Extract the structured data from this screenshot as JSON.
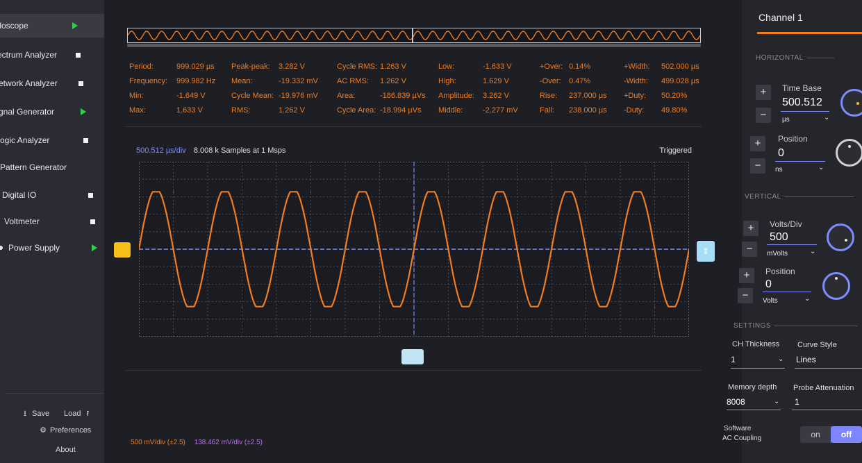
{
  "colors": {
    "channel1": "#f07d22",
    "accent": "#7e8cff",
    "trigger_yellow": "#f6c21a",
    "math": "#c46bff"
  },
  "sidebar": {
    "items": [
      {
        "label": "illoscope",
        "indicator": "play",
        "active": true
      },
      {
        "label": "ectrum Analyzer",
        "indicator": "square"
      },
      {
        "label": "etwork Analyzer",
        "indicator": "square"
      },
      {
        "label": "gnal Generator",
        "indicator": "play"
      },
      {
        "label": "ogic Analyzer",
        "indicator": "square"
      },
      {
        "label": "Pattern Generator",
        "indicator": "none"
      },
      {
        "label": "Digital IO",
        "indicator": "square"
      },
      {
        "label": "Voltmeter",
        "indicator": "square"
      },
      {
        "label": "Power Supply",
        "indicator": "play"
      }
    ],
    "save_label": "Save",
    "load_label": "Load",
    "preferences_label": "Preferences",
    "about_label": "About"
  },
  "measurements": {
    "col1": [
      {
        "key": "Period:",
        "value": "999.029 µs"
      },
      {
        "key": "Frequency:",
        "value": "999.982 Hz"
      },
      {
        "key": "Min:",
        "value": "-1.649 V"
      },
      {
        "key": "Max:",
        "value": "1.633 V"
      }
    ],
    "col2": [
      {
        "key": "Peak-peak:",
        "value": "3.282 V"
      },
      {
        "key": "Mean:",
        "value": "-19.332 mV"
      },
      {
        "key": "Cycle Mean:",
        "value": "-19.976 mV"
      },
      {
        "key": "RMS:",
        "value": "1.262 V"
      }
    ],
    "col3": [
      {
        "key": "Cycle RMS:",
        "value": "1.263 V"
      },
      {
        "key": "AC RMS:",
        "value": "1.262 V"
      },
      {
        "key": "Area:",
        "value": "-186.839 µVs"
      },
      {
        "key": "Cycle Area:",
        "value": "-18.994 µVs"
      }
    ],
    "col4": [
      {
        "key": "Low:",
        "value": "-1.633 V"
      },
      {
        "key": "High:",
        "value": "1.629 V"
      },
      {
        "key": "Amplitude:",
        "value": "3.262 V"
      },
      {
        "key": "Middle:",
        "value": "-2.277 mV"
      }
    ],
    "col5": [
      {
        "key": "+Over:",
        "value": "0.14%"
      },
      {
        "key": "-Over:",
        "value": "0.47%"
      },
      {
        "key": "Rise:",
        "value": "237.000 µs"
      },
      {
        "key": "Fall:",
        "value": "238.000 µs"
      }
    ],
    "col6": [
      {
        "key": "+Width:",
        "value": "502.000 µs"
      },
      {
        "key": "-Width:",
        "value": "499.028 µs"
      },
      {
        "key": "+Duty:",
        "value": "50.20%"
      },
      {
        "key": "-Duty:",
        "value": "49.80%"
      }
    ]
  },
  "plot": {
    "time_per_div": "500.512 µs/div",
    "samples_info": "8.008 k Samples at 1 Msps",
    "trigger_status": "Triggered",
    "ch1_scale": "500 mV/div (±2.5)",
    "math_scale": "138.462 mV/div (±2.5)",
    "trigger_marker_glyph": "⇕"
  },
  "chart_data": {
    "type": "line",
    "title": "",
    "xlabel": "",
    "ylabel": "",
    "x_unit": "µs",
    "y_unit": "V",
    "xlim": [
      0,
      8000
    ],
    "ylim": [
      -2.5,
      2.5
    ],
    "grid": true,
    "series": [
      {
        "x": [
          0,
          500,
          1000,
          1500,
          2000,
          2500,
          3000,
          3500,
          4000,
          4500,
          5000,
          5500,
          6000,
          6500,
          7000,
          7500,
          8000
        ],
        "y": [
          0,
          1.633,
          0,
          -1.649,
          0,
          1.633,
          0,
          -1.649,
          0,
          1.633,
          0,
          -1.649,
          0,
          1.633,
          0,
          -1.649,
          0
        ]
      }
    ]
  },
  "rpanel": {
    "channel_title": "Channel 1",
    "horizontal_section": "HORIZONTAL",
    "time_base_label": "Time Base",
    "time_base_value": "500.512",
    "time_base_unit": "µs",
    "h_position_label": "Position",
    "h_position_value": "0",
    "h_position_unit": "ns",
    "vertical_section": "VERTICAL",
    "volts_div_label": "Volts/Div",
    "volts_div_value": "500",
    "volts_div_unit": "mVolts",
    "v_position_label": "Position",
    "v_position_value": "0",
    "v_position_unit": "Volts",
    "settings_section": "SETTINGS",
    "ch_thickness_label": "CH Thickness",
    "ch_thickness_value": "1",
    "curve_style_label": "Curve Style",
    "curve_style_value": "Lines",
    "memory_depth_label": "Memory depth",
    "memory_depth_value": "8008",
    "probe_att_label": "Probe Attenuation",
    "probe_att_value": "1",
    "ac_coupling_label_1": "Software",
    "ac_coupling_label_2": "AC Coupling",
    "toggle_on": "on",
    "toggle_off": "off",
    "plus": "+",
    "minus": "−",
    "chevron": "⌄"
  }
}
